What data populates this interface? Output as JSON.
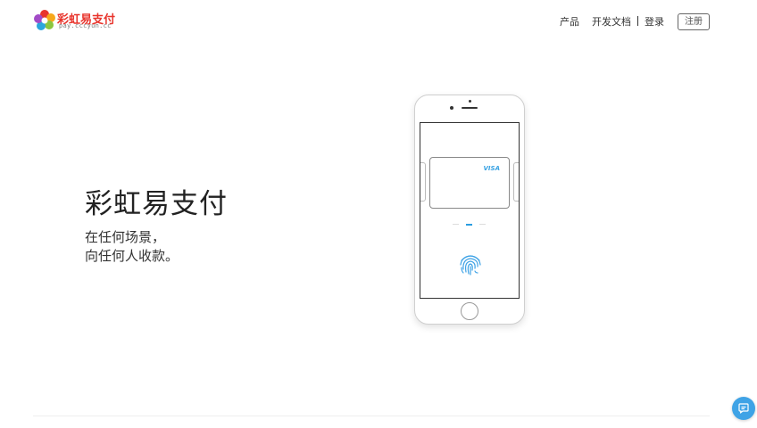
{
  "header": {
    "logo_title": "彩虹易支付",
    "logo_subtitle": "pay.cccyun.cc",
    "nav": {
      "products": "产品",
      "docs": "开发文档",
      "login": "登录",
      "register": "注册"
    }
  },
  "hero": {
    "title": "彩虹易支付",
    "line1": "在任何场景，",
    "line2": "向任何人收款。"
  },
  "phone": {
    "card_brand": "VISA",
    "carousel_active_index": 1,
    "carousel_count": 3
  },
  "colors": {
    "accent": "#3fa3e6",
    "logo_red": "#e8342c"
  },
  "icons": {
    "logo": "rainbow-flower-logo",
    "fingerprint": "fingerprint-icon",
    "chat": "chat-bubble-icon"
  }
}
